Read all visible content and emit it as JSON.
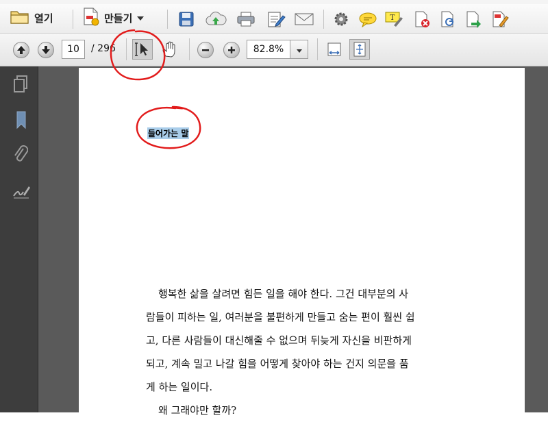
{
  "toolbar": {
    "open_label": "열기",
    "create_label": "만들기"
  },
  "nav": {
    "current_page": "10",
    "page_total": "/ 296",
    "zoom_value": "82.8%"
  },
  "document": {
    "heading": "들어가는 말",
    "lines": [
      "행복한 삶을 살려면 힘든 일을 해야 한다. 그건 대부분의 사",
      "람들이 피하는 일, 여러분을 불편하게 만들고 숨는 편이 훨씬 쉽",
      "고, 다른 사람들이 대신해줄 수 없으며 뒤늦게 자신을 비판하게",
      "되고, 계속 밀고 나갈 힘을 어떻게 찾아야 하는 건지 의문을 품",
      "게 하는 일이다.",
      "왜 그래야만 할까?"
    ]
  },
  "icons": {
    "toolbar1": [
      "folder-icon",
      "create-pdf-icon",
      "save-icon",
      "cloud-upload-icon",
      "print-icon",
      "edit-document-icon",
      "email-icon",
      "settings-icon",
      "comment-icon",
      "highlight-icon",
      "delete-page-icon",
      "rotate-page-icon",
      "export-icon",
      "sign-icon"
    ],
    "toolbar2": [
      "previous-page-icon",
      "next-page-icon",
      "select-tool-icon",
      "hand-tool-icon",
      "zoom-out-icon",
      "zoom-in-icon",
      "fit-width-icon",
      "fit-page-icon"
    ],
    "sidebar": [
      "pages-icon",
      "bookmark-icon",
      "attachment-icon",
      "signature-icon"
    ]
  },
  "colors": {
    "highlight": "#a9cdea",
    "annotation_red": "#e21b1b",
    "viewer_bg": "#5a5a5a",
    "sidebar_bg": "#3d3d3d"
  }
}
